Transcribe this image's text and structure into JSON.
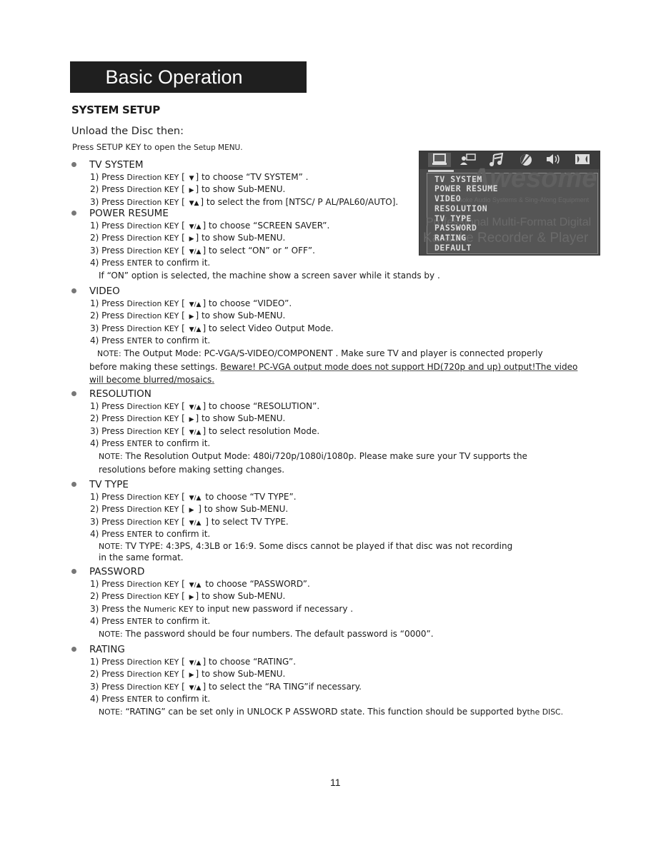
{
  "banner": {
    "title": "Basic Operation"
  },
  "heading": "SYSTEM SETUP",
  "intro": {
    "line1": "Unload the Disc then:",
    "line2_pre": "Press ",
    "line2_key": "SETUP KEY",
    "line2_post": " to open the ",
    "line2_menu": "Setup MENU."
  },
  "osd": {
    "tabs": [
      {
        "icon": "tv-monitor-icon",
        "glyph": "🖵",
        "active": true
      },
      {
        "icon": "user-chat-icon",
        "glyph": "👤"
      },
      {
        "icon": "music-note-icon",
        "glyph": "♫"
      },
      {
        "icon": "color-disc-icon",
        "glyph": "◐"
      },
      {
        "icon": "speaker-icon",
        "glyph": "🔊"
      },
      {
        "icon": "dolby-icon",
        "glyph": "◨◧"
      }
    ],
    "items": [
      "TV SYSTEM",
      "POWER RESUME",
      "VIDEO",
      "RESOLUTION",
      "TV TYPE",
      "PASSWORD",
      "RATING",
      "DEFAULT"
    ],
    "background_text": [
      "Awesome",
      "Karaoke Audio Systems & Sing-Along Equipment",
      "Professional Multi-Format Digital",
      "Karaoke Recorder & Player"
    ]
  },
  "sections": [
    {
      "title": "TV SYSTEM",
      "steps": [
        {
          "pre": "1) Press ",
          "kw": "Direction KEY",
          "mid": " [ ",
          "arrow": "▼",
          "post": "] to choose “TV SYSTEM” ."
        },
        {
          "pre": "2) Press ",
          "kw": "Direction KEY",
          "mid": " [ ",
          "arrow": "▶",
          "post": "] to show Sub-MENU."
        },
        {
          "pre": "3) Press ",
          "kw": "Direction KEY",
          "mid": " [ ",
          "arrow": "▼▲",
          "post": "] to select the from  [NTSC/ P  AL/PAL60/AUTO]."
        }
      ]
    },
    {
      "title": "POWER RESUME",
      "steps": [
        {
          "pre": "1) Press ",
          "kw": "Direction KEY",
          "mid": " [ ",
          "arrow": "▼/▲",
          "post": "] to choose “SCREEN SAVER”."
        },
        {
          "pre": "2) Press ",
          "kw": "Direction KEY",
          "mid": " [ ",
          "arrow": "▶",
          "post": "] to show Sub-MENU."
        },
        {
          "pre": "3) Press ",
          "kw": "Direction KEY",
          "mid": " [ ",
          "arrow": "▼/▲",
          "post": "] to select  “ON” or ” OFF”."
        },
        {
          "pre": "4) Press ",
          "kw": "ENTER",
          "mid": " to confirm it.",
          "arrow": "",
          "post": ""
        }
      ],
      "note": "If “ON” option is selected, the machine show a screen saver while it stands by ."
    },
    {
      "title": "VIDEO",
      "steps": [
        {
          "pre": "1) Press ",
          "kw": "Direction KEY",
          "mid": " [ ",
          "arrow": "▼/▲",
          "post": "] to choose “VIDEO”."
        },
        {
          "pre": "2) Press ",
          "kw": "Direction KEY",
          "mid": " [ ",
          "arrow": "▶",
          "post": "] to show Sub-MENU."
        },
        {
          "pre": "3) Press ",
          "kw": "Direction KEY",
          "mid": " [ ",
          "arrow": "▼/▲",
          "post": "] to select  Video Output Mode."
        },
        {
          "pre": "4) Press ",
          "kw": "ENTER",
          "mid": " to confirm it.",
          "arrow": "",
          "post": ""
        }
      ],
      "note_label": "NOTE:",
      "note_line1": " The Output Mode: PC-VGA/S-VIDEO/COMPONENT    . Make sure TV and player is connected properly",
      "note_line2_plain": "before making these settings. ",
      "note_line2_underlined": "Beware! PC-VGA   output mode does not support HD(720p and up) output!The video",
      "note_line3_underlined": "will become blurred/mosaics."
    },
    {
      "title": "RESOLUTION",
      "steps": [
        {
          "pre": "1) Press ",
          "kw": "Direction KEY",
          "mid": " [ ",
          "arrow": "▼/▲",
          "post": "] to choose “RESOLUTION”."
        },
        {
          "pre": "2) Press ",
          "kw": "Direction KEY",
          "mid": " [ ",
          "arrow": "▶",
          "post": "] to show Sub-MENU."
        },
        {
          "pre": "3) Press ",
          "kw": "Direction KEY",
          "mid": " [ ",
          "arrow": "▼/▲",
          "post": "] to select  resolution Mode."
        },
        {
          "pre": "4) Press ",
          "kw": "ENTER",
          "mid": " to confirm it.",
          "arrow": "",
          "post": ""
        }
      ],
      "note_label": "NOTE:",
      "note_line1": " The Resolution Output Mode: 480i/720p/1080i/1080p. Please make sure your      TV supports the",
      "note_line2": "resolutions before making setting changes."
    },
    {
      "title": "TV TYPE",
      "steps": [
        {
          "pre": "1) Press ",
          "kw": "Direction KEY",
          "mid": " [ ",
          "arrow": "▼/▲",
          "post": "  to choose “TV TYPE”."
        },
        {
          "pre": "2) Press ",
          "kw": "Direction KEY",
          "mid": " [ ",
          "arrow": "▶",
          "post": " ] to show Sub-MENU."
        },
        {
          "pre": "3) Press ",
          "kw": "Direction KEY",
          "mid": " [ ",
          "arrow": "▼/▲",
          "post": " ]  to select TV TYPE."
        },
        {
          "pre": "4) Press ",
          "kw": "ENTER",
          "mid": " to confirm it.",
          "arrow": "",
          "post": ""
        }
      ],
      "note_label": "NOTE:",
      "note_line1": " TV TYPE: 4:3PS, 4:3LB or 16:9. Some discs cannot be played if        that disc was not recording",
      "note_line2": "in the same format."
    },
    {
      "title": "PASSWORD",
      "steps": [
        {
          "pre": "1) Press ",
          "kw": "Direction KEY",
          "mid": " [ ",
          "arrow": "▼/▲",
          "post": "  to choose  “PASSWORD”."
        },
        {
          "pre": "2) Press ",
          "kw": "Direction KEY",
          "mid": " [ ",
          "arrow": "▶",
          "post": "] to show Sub-MENU."
        },
        {
          "pre": "3) Press the ",
          "kw": "Numeric KEY",
          "mid": " to input new password if necessary    .",
          "arrow": "",
          "post": ""
        },
        {
          "pre": "4) Press ",
          "kw": "ENTER",
          "mid": " to confirm it.",
          "arrow": "",
          "post": ""
        }
      ],
      "note_label": "NOTE:",
      "note_line1": " The password should be four numbers.   The default password is “0000”."
    },
    {
      "title": "RATING",
      "steps": [
        {
          "pre": "1) Press ",
          "kw": "Direction KEY",
          "mid": " [ ",
          "arrow": "▼/▲",
          "post": "]  to choose  “RATING”."
        },
        {
          "pre": "2) Press ",
          "kw": "Direction KEY",
          "mid": " [ ",
          "arrow": "▶",
          "post": "] to show Sub-MENU."
        },
        {
          "pre": "3) Press ",
          "kw": "Direction KEY",
          "mid": " [ ",
          "arrow": "▼/▲",
          "post": "]  to select the “RA    TING”if necessary."
        },
        {
          "pre": "4) Press ",
          "kw": "ENTER",
          "mid": " to confirm it.",
          "arrow": "",
          "post": ""
        }
      ],
      "note_label": "NOTE:",
      "note_line1": " “RATING” can be set only in UNLOCK P     ASSWORD state. This function should be supported by",
      "note_tail_kw": "the DISC."
    }
  ],
  "page_number": "11"
}
